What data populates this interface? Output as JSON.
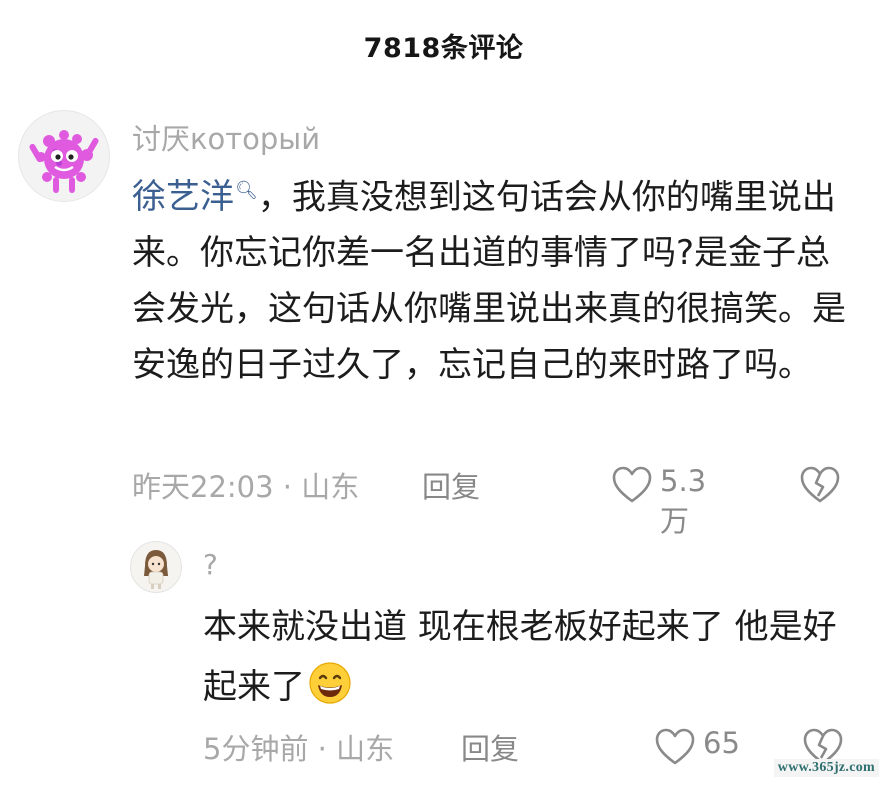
{
  "header": {
    "title": "7818条评论"
  },
  "comment": {
    "username": "讨厌который",
    "mention": "徐艺洋",
    "text_after_mention": "，我真没想到这句话会从你的嘴里说出来。你忘记你差一名出道的事情了吗?是金子总会发光，这句话从你嘴里说出来真的很搞笑。是安逸的日子过久了，忘记自己的来时路了吗。",
    "time": "昨天22:03 · 山东",
    "reply_label": "回复",
    "like_count": "5.3万",
    "icons": {
      "mention": "search-icon",
      "like": "heart-icon",
      "dislike": "broken-heart-icon"
    }
  },
  "reply": {
    "username": "?",
    "text": "本来就没出道 现在根老板好起来了 他是好起来了",
    "emoji": "grinning-face-emoji",
    "time": "5分钟前 · 山东",
    "reply_label": "回复",
    "like_count": "65"
  },
  "watermark": "www.365jz.com",
  "colors": {
    "mention": "#3b5f91",
    "muted": "#a8a8a8",
    "text": "#1c1c1c"
  }
}
